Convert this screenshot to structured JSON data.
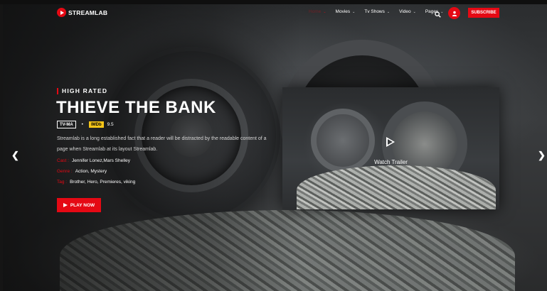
{
  "brand": {
    "name": "STREAMLAB",
    "accent": "#e50914"
  },
  "nav": {
    "items": [
      {
        "label": "Home",
        "active": true
      },
      {
        "label": "Movies",
        "active": false
      },
      {
        "label": "Tv Shows",
        "active": false
      },
      {
        "label": "Video",
        "active": false
      },
      {
        "label": "Pages",
        "active": false
      }
    ],
    "search_icon": "search-icon",
    "user_icon": "user-icon",
    "subscribe_label": "SUBSCRIBE"
  },
  "hero": {
    "tag": "HIGH RATED",
    "title": "THIEVE THE BANK",
    "rating": "TV-MA",
    "separator": "•",
    "imdb_label": "IMDb",
    "imdb_score": "9.5",
    "description": "Streamlab is a long established fact that a reader will be distracted by the readable content of a page when Streamlab at its layout Streamlab.",
    "cast_key": "Cast :",
    "cast_value": "Jennifer Lonez,Mars Shelley",
    "genre_key": "Genre :",
    "genre_value": "Action, Mystery",
    "tag_key": "Tag :",
    "tag_value": "Brother, Hero, Premieres, viking",
    "play_label": "PLAY NOW"
  },
  "trailer": {
    "label": "Watch Trailer",
    "icon": "play-icon"
  },
  "slider": {
    "prev_icon": "chevron-left-icon",
    "next_icon": "chevron-right-icon",
    "prev_glyph": "❮",
    "next_glyph": "❯"
  }
}
